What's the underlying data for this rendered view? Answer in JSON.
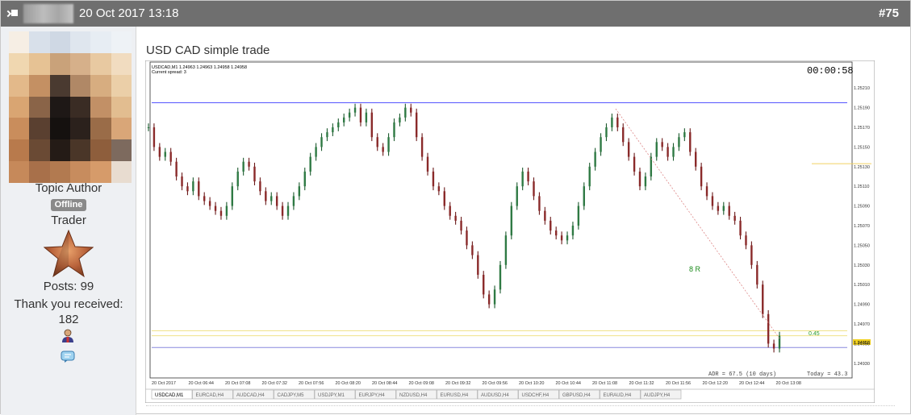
{
  "header": {
    "date": "20 Oct 2017 13:18",
    "post_number": "#75"
  },
  "sidebar": {
    "role": "Topic Author",
    "status": "Offline",
    "rank": "Trader",
    "posts": "Posts: 99",
    "thanks_label": "Thank you received:",
    "thanks_count": "182"
  },
  "post": {
    "title": "USD CAD simple trade"
  },
  "chart_data": {
    "type": "line",
    "header_line": "USDCAD,M1  1.24963 1.24963 1.24958 1.24958",
    "header_line2": "Current spread: 3",
    "timer": "00:00:58",
    "annotation": "8 R",
    "label_045": "0.45",
    "current_price": "1.24958",
    "adr_text": "ADR = 67.5  (10 days)",
    "today_text": "Today = 43.3",
    "y_ticks": [
      "1.25210",
      "1.25190",
      "1.25170",
      "1.25150",
      "1.25130",
      "1.25110",
      "1.25090",
      "1.25070",
      "1.25050",
      "1.25030",
      "1.25010",
      "1.24990",
      "1.24970",
      "1.24950",
      "1.24930"
    ],
    "x_ticks": [
      "20 Oct 2017",
      "20 Oct 06:44",
      "20 Oct 07:08",
      "20 Oct 07:32",
      "20 Oct 07:56",
      "20 Oct 08:20",
      "20 Oct 08:44",
      "20 Oct 09:08",
      "20 Oct 09:32",
      "20 Oct 09:56",
      "20 Oct 10:20",
      "20 Oct 10:44",
      "20 Oct 11:08",
      "20 Oct 11:32",
      "20 Oct 11:56",
      "20 Oct 12:20",
      "20 Oct 12:44",
      "20 Oct 13:08"
    ],
    "tabs": [
      "USDCAD,M1",
      "EURCAD,H4",
      "AUDCAD,H4",
      "CADJPY,M5",
      "USDJPY,M1",
      "EURJPY,H4",
      "NZDUSD,H4",
      "EURUSD,H4",
      "AUDUSD,H4",
      "USDCHF,H4",
      "GBPUSD,H4",
      "EURAUD,H4",
      "AUDJPY,H4"
    ],
    "ylim": [
      1.2492,
      1.2522
    ],
    "hlines": [
      {
        "value": 1.25195,
        "color": "#5555ff"
      },
      {
        "value": 1.24963,
        "color": "#f0e28a"
      },
      {
        "value": 1.24958,
        "color": "#f0e28a"
      },
      {
        "value": 1.24946,
        "color": "#8888dd"
      },
      {
        "value": 1.25133,
        "color": "#f0d060"
      }
    ],
    "series": [
      {
        "values": [
          1.2517,
          1.2515,
          1.2514,
          1.25145,
          1.25135,
          1.2512,
          1.2511,
          1.25105,
          1.25115,
          1.251,
          1.25095,
          1.2509,
          1.25085,
          1.2508,
          1.2509,
          1.2511,
          1.25125,
          1.25135,
          1.2513,
          1.25115,
          1.25105,
          1.25095,
          1.251,
          1.2509,
          1.2508,
          1.2509,
          1.251,
          1.2511,
          1.25125,
          1.2514,
          1.2515,
          1.2516,
          1.25165,
          1.2517,
          1.25175,
          1.2518,
          1.25185,
          1.2519,
          1.25175,
          1.25185,
          1.2516,
          1.2515,
          1.25145,
          1.2516,
          1.25175,
          1.2518,
          1.2519,
          1.25185,
          1.2516,
          1.2514,
          1.25125,
          1.2511,
          1.25105,
          1.2509,
          1.2508,
          1.25075,
          1.25065,
          1.2505,
          1.2504,
          1.2502,
          1.25,
          1.2499,
          1.25005,
          1.2503,
          1.2506,
          1.2509,
          1.2511,
          1.25125,
          1.25115,
          1.251,
          1.25085,
          1.25075,
          1.25065,
          1.2506,
          1.25055,
          1.2506,
          1.2507,
          1.2509,
          1.2511,
          1.2513,
          1.25145,
          1.2516,
          1.2517,
          1.2518,
          1.2517,
          1.25155,
          1.2514,
          1.25125,
          1.2511,
          1.2512,
          1.2514,
          1.25155,
          1.2515,
          1.2514,
          1.2515,
          1.2516,
          1.25165,
          1.25145,
          1.2513,
          1.2511,
          1.251,
          1.2509,
          1.25085,
          1.2509,
          1.2508,
          1.25075,
          1.2506,
          1.2505,
          1.2503,
          1.2501,
          1.2498,
          1.2495,
          1.24945,
          1.24958
        ]
      }
    ]
  }
}
